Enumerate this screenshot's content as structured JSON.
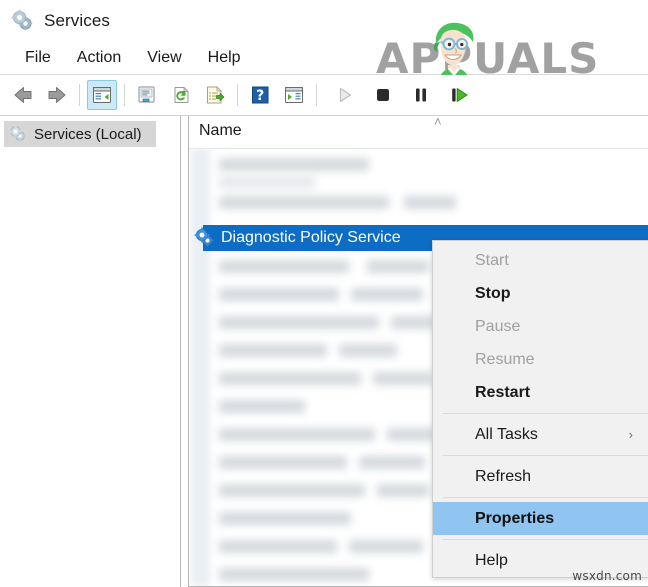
{
  "window": {
    "title": "Services",
    "icon": "services-gear-icon"
  },
  "menubar": {
    "items": [
      {
        "label": "File"
      },
      {
        "label": "Action"
      },
      {
        "label": "View"
      },
      {
        "label": "Help"
      }
    ]
  },
  "toolbar": {
    "buttons": [
      {
        "name": "back-icon",
        "label": "Back"
      },
      {
        "name": "forward-icon",
        "label": "Forward"
      },
      {
        "name": "show-hide-console-tree-icon",
        "label": "Show/Hide Console Tree",
        "active": true
      },
      {
        "name": "properties-icon",
        "label": "Properties"
      },
      {
        "name": "refresh-icon",
        "label": "Refresh"
      },
      {
        "name": "export-list-icon",
        "label": "Export List"
      },
      {
        "name": "help-icon",
        "label": "Help"
      },
      {
        "name": "show-action-pane-icon",
        "label": "Show Action Pane"
      },
      {
        "name": "start-service-icon",
        "label": "Start Service",
        "disabled": true
      },
      {
        "name": "stop-service-icon",
        "label": "Stop Service"
      },
      {
        "name": "pause-service-icon",
        "label": "Pause Service"
      },
      {
        "name": "restart-service-icon",
        "label": "Restart Service"
      }
    ]
  },
  "sidebar": {
    "items": [
      {
        "label": "Services (Local)",
        "icon": "services-gear-icon",
        "selected": true
      }
    ]
  },
  "list": {
    "columns": [
      {
        "label": "Name",
        "sort": "ascending",
        "sort_glyph": "˄"
      }
    ],
    "selected_row": {
      "name": "Diagnostic Policy Service",
      "icon": "service-gear-icon"
    }
  },
  "context_menu": {
    "items": [
      {
        "label": "Start",
        "disabled": true,
        "selected": false,
        "bold": false,
        "submenu": false
      },
      {
        "label": "Stop",
        "disabled": false,
        "selected": false,
        "bold": true,
        "submenu": false
      },
      {
        "label": "Pause",
        "disabled": true,
        "selected": false,
        "bold": false,
        "submenu": false
      },
      {
        "label": "Resume",
        "disabled": true,
        "selected": false,
        "bold": false,
        "submenu": false
      },
      {
        "label": "Restart",
        "disabled": false,
        "selected": false,
        "bold": true,
        "submenu": false
      },
      {
        "label": "All Tasks",
        "disabled": false,
        "selected": false,
        "bold": false,
        "submenu": true,
        "submenu_glyph": "›",
        "separator_before": true
      },
      {
        "label": "Refresh",
        "disabled": false,
        "selected": false,
        "bold": false,
        "submenu": false,
        "separator_before": true
      },
      {
        "label": "Properties",
        "disabled": false,
        "selected": true,
        "bold": true,
        "submenu": false,
        "separator_before": true
      },
      {
        "label": "Help",
        "disabled": false,
        "selected": false,
        "bold": false,
        "submenu": false,
        "separator_before": true
      }
    ]
  },
  "watermarks": {
    "brand": "APPUALS",
    "footer": "wsxdn.com"
  },
  "colors": {
    "row_selection_blue": "#0d6cc4",
    "menu_highlight_blue": "#8fc5f0",
    "menu_background": "#f1f1f1",
    "toolbar_active": "#cde8f7",
    "sidebar_selection": "#d6d6d6",
    "watermark_gray": "#9a9a9a"
  }
}
